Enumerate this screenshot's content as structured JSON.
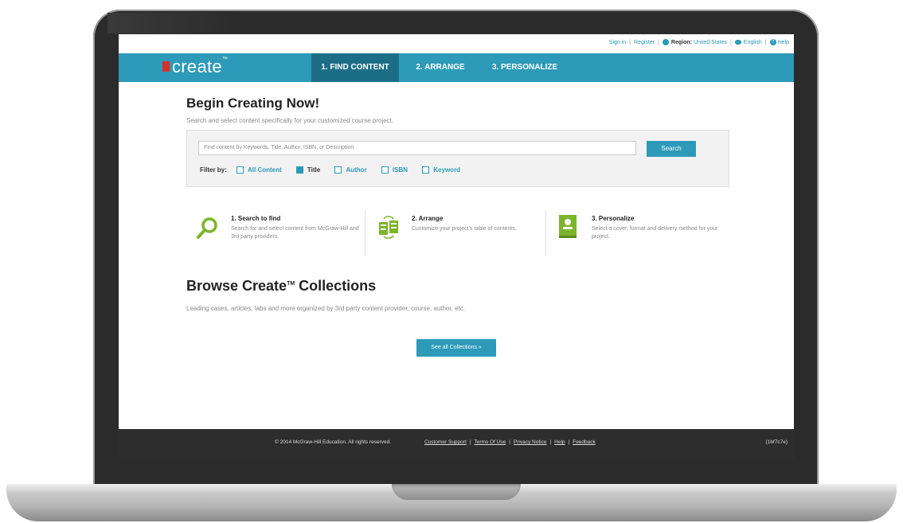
{
  "utility": {
    "sign_in": "Sign in",
    "register": "Register",
    "region_label": "Region:",
    "region_value": "United States",
    "language": "English",
    "help": "Help"
  },
  "nav": {
    "logo": "create",
    "logo_tm": "™",
    "tabs": [
      {
        "label": "1. FIND CONTENT",
        "active": true
      },
      {
        "label": "2. ARRANGE",
        "active": false
      },
      {
        "label": "3. PERSONALIZE",
        "active": false
      }
    ]
  },
  "main": {
    "title": "Begin Creating Now!",
    "subtitle": "Search and select content specifically for your customized course project.",
    "search": {
      "placeholder": "Find content by Keywords, Title, Author, ISBN, or Description",
      "button": "Search"
    },
    "filter": {
      "label": "Filter by:",
      "options": [
        {
          "label": "All Content",
          "checked": false
        },
        {
          "label": "Title",
          "checked": true
        },
        {
          "label": "Author",
          "checked": false
        },
        {
          "label": "ISBN",
          "checked": false
        },
        {
          "label": "Keyword",
          "checked": false
        }
      ]
    },
    "steps": [
      {
        "title": "1. Search to find",
        "text": "Search for and select content from McGraw-Hill and 3rd party providers.",
        "icon": "magnifier-icon"
      },
      {
        "title": "2. Arrange",
        "text": "Customize your project's table of contents.",
        "icon": "arrange-icon"
      },
      {
        "title": "3. Personalize",
        "text": "Select a cover, format and delivery method for your project.",
        "icon": "book-icon"
      }
    ]
  },
  "collections": {
    "title": "Browse Create",
    "title_tm": "TM",
    "title_rest": " Collections",
    "subtitle": "Leading cases, articles, labs and more organized by 3rd party content provider, course, author, etc.",
    "button": "See all Collections »"
  },
  "footer": {
    "copyright": "© 2014 McGraw-Hill Education. All rights reserved.",
    "links": [
      "Customer Support",
      "Terms Of Use",
      "Privacy Notice",
      "Help",
      "Feedback"
    ],
    "build": "(1bf7c7e)"
  },
  "colors": {
    "accent": "#2c9ab8",
    "active_tab": "#1c6e86",
    "logo_red": "#d6322b",
    "footer": "#2d2d2d"
  }
}
